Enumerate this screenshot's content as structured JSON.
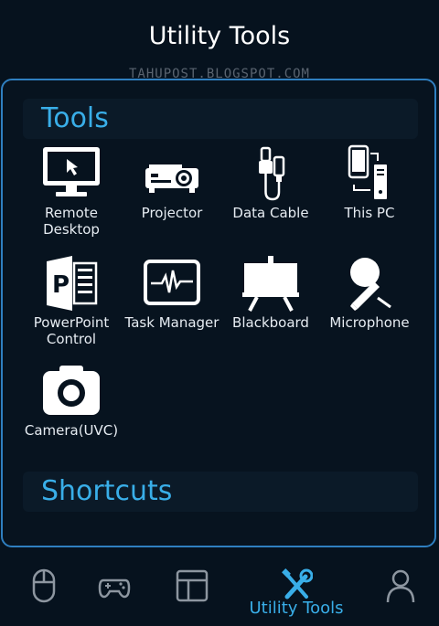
{
  "header": {
    "title": "Utility Tools"
  },
  "watermark": "TAHUPOST.BLOGSPOT.COM",
  "sections": {
    "tools": {
      "title": "Tools",
      "items": [
        {
          "label_1": "Remote",
          "label_2": "Desktop",
          "icon": "remote-desktop-icon"
        },
        {
          "label_1": "Projector",
          "label_2": "",
          "icon": "projector-icon"
        },
        {
          "label_1": "Data Cable",
          "label_2": "",
          "icon": "data-cable-icon"
        },
        {
          "label_1": "This PC",
          "label_2": "",
          "icon": "this-pc-icon"
        },
        {
          "label_1": "PowerPoint",
          "label_2": "Control",
          "icon": "powerpoint-icon"
        },
        {
          "label_1": "Task Manager",
          "label_2": "",
          "icon": "task-manager-icon"
        },
        {
          "label_1": "Blackboard",
          "label_2": "",
          "icon": "blackboard-icon"
        },
        {
          "label_1": "Microphone",
          "label_2": "",
          "icon": "microphone-icon"
        },
        {
          "label_1": "Camera(UVC)",
          "label_2": "",
          "icon": "camera-icon"
        }
      ]
    },
    "shortcuts": {
      "title": "Shortcuts"
    }
  },
  "bottom_nav": {
    "items": [
      {
        "icon": "mouse-icon",
        "label": ""
      },
      {
        "icon": "gamepad-icon",
        "label": ""
      },
      {
        "icon": "layout-icon",
        "label": ""
      },
      {
        "icon": "wrench-screwdriver-icon",
        "label": "Utility Tools",
        "active": true
      },
      {
        "icon": "user-icon",
        "label": ""
      }
    ]
  },
  "colors": {
    "background": "#06121e",
    "accent": "#39aee8",
    "panel_border": "#2f7fc0",
    "nav_icon": "#8d96a0"
  }
}
